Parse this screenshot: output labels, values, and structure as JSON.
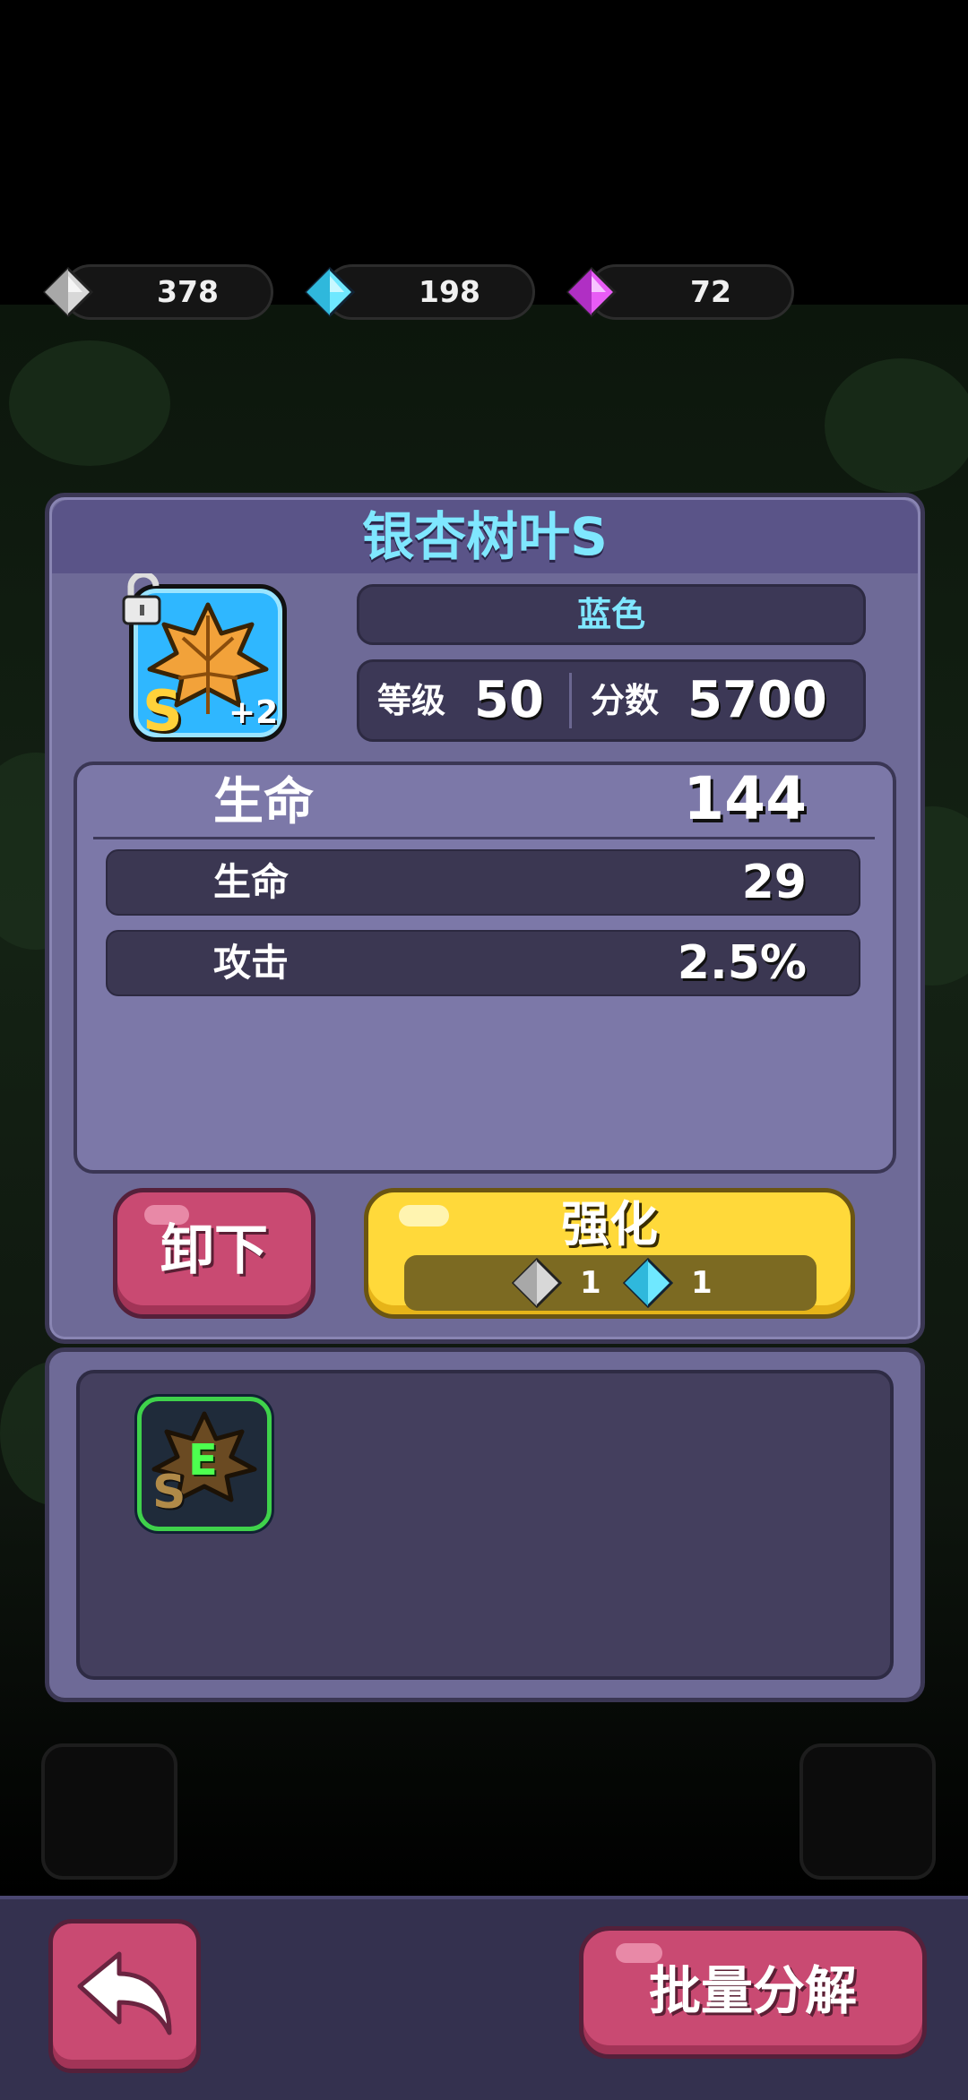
{
  "currencies": [
    {
      "icon": "silver-gem-icon",
      "color": "#cfcfcf",
      "amount": "378"
    },
    {
      "icon": "cyan-gem-icon",
      "color": "#5fe3ff",
      "amount": "198"
    },
    {
      "icon": "purple-gem-icon",
      "color": "#e24ff0",
      "amount": "72"
    }
  ],
  "item": {
    "name": "银杏树叶S",
    "color_label": "蓝色",
    "level_label": "等级",
    "level": "50",
    "score_label": "分数",
    "score": "5700",
    "grade_letter": "S",
    "plus": "+2"
  },
  "stats": {
    "main_label": "生命",
    "main_value": "144",
    "sub": [
      {
        "label": "生命",
        "value": "29"
      },
      {
        "label": "攻击",
        "value": "2.5%"
      }
    ]
  },
  "actions": {
    "unequip_label": "卸下",
    "enhance_label": "强化",
    "enhance_cost": [
      {
        "icon": "silver-gem-icon",
        "amount": "1"
      },
      {
        "icon": "cyan-gem-icon",
        "amount": "1"
      }
    ]
  },
  "inventory": {
    "items": [
      {
        "badge": "E",
        "grade_letter": "S"
      }
    ]
  },
  "bottom": {
    "bulk_decompose_label": "批量分解"
  },
  "colors": {
    "title": "#7fe7ff",
    "enhance_button": "#ffd93a",
    "pink_button": "#c94a72",
    "panel": "#6e6a97"
  }
}
